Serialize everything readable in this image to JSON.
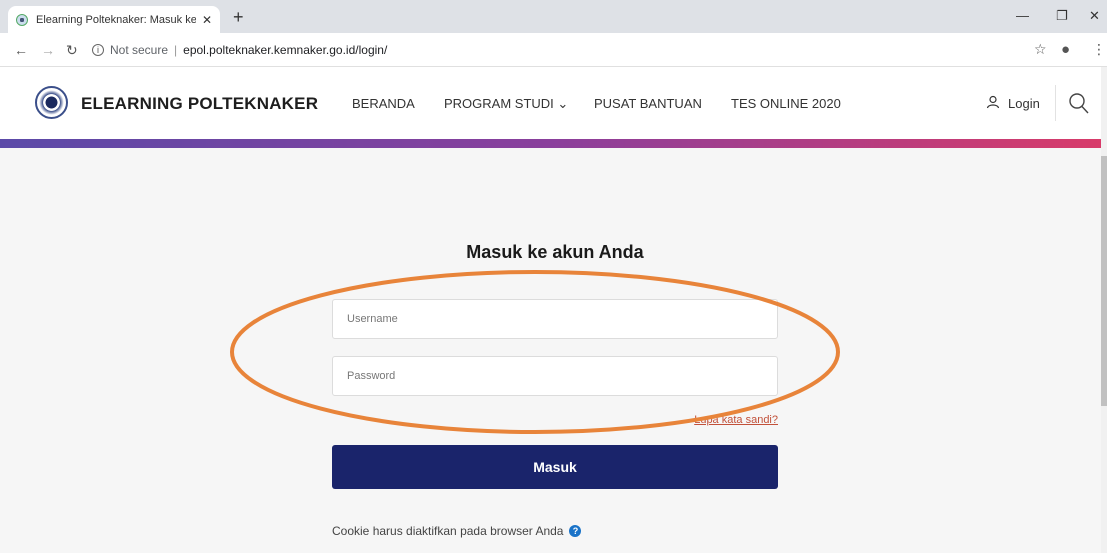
{
  "browser": {
    "tab_title": "Elearning Polteknaker: Masuk ke",
    "tab_close": "✕",
    "new_tab": "+",
    "security_label": "Not secure",
    "url": "epol.polteknaker.kemnaker.go.id/login/",
    "controls": {
      "minimize": "—",
      "restore": "❐",
      "close": "✕"
    }
  },
  "site": {
    "brand": "ELEARNING POLTEKNAKER",
    "menu": [
      {
        "label": "BERANDA"
      },
      {
        "label": "PROGRAM STUDI ⌄"
      },
      {
        "label": "PUSAT BANTUAN"
      },
      {
        "label": "TES ONLINE 2020"
      }
    ],
    "login_label": "Login"
  },
  "login_form": {
    "title": "Masuk ke akun Anda",
    "username_placeholder": "Username",
    "password_placeholder": "Password",
    "forgot_label": "Lupa kata sandi?",
    "submit_label": "Masuk",
    "cookie_notice": "Cookie harus diaktifkan pada browser Anda"
  },
  "colors": {
    "submit_bg": "#1a246b",
    "annotation": "#e8843a",
    "gradient_start": "#5b4aa8",
    "gradient_end": "#d83b6a",
    "link": "#c2513a"
  },
  "icons": [
    "back-arrow-icon",
    "forward-arrow-icon",
    "reload-icon",
    "info-icon",
    "star-icon",
    "account-icon",
    "menu-dots-icon",
    "user-icon",
    "search-icon",
    "help-icon"
  ]
}
